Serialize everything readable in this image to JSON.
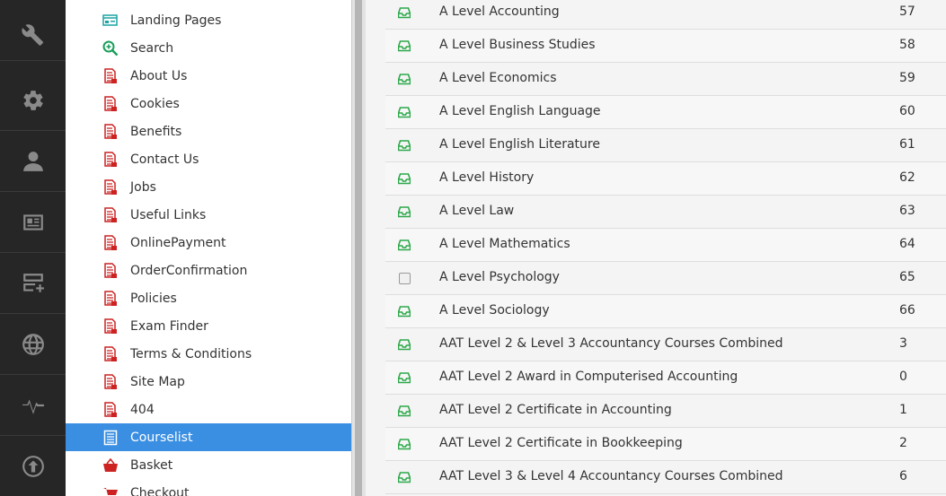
{
  "rail": {
    "icons": [
      "wrench-icon",
      "gear-icon",
      "user-icon",
      "id-card-icon",
      "server-add-icon",
      "globe-icon",
      "pulse-icon",
      "upload-icon"
    ]
  },
  "tree": {
    "items": [
      {
        "label": "Landing Pages",
        "icon": "landing-pages-icon"
      },
      {
        "label": "Search",
        "icon": "search-icon"
      },
      {
        "label": "About Us",
        "icon": "page-icon"
      },
      {
        "label": "Cookies",
        "icon": "page-icon"
      },
      {
        "label": "Benefits",
        "icon": "page-icon"
      },
      {
        "label": "Contact Us",
        "icon": "page-icon"
      },
      {
        "label": "Jobs",
        "icon": "page-icon"
      },
      {
        "label": "Useful Links",
        "icon": "page-icon"
      },
      {
        "label": "OnlinePayment",
        "icon": "page-icon"
      },
      {
        "label": "OrderConfirmation",
        "icon": "page-icon"
      },
      {
        "label": "Policies",
        "icon": "page-icon"
      },
      {
        "label": "Exam Finder",
        "icon": "page-icon"
      },
      {
        "label": "Terms & Conditions",
        "icon": "page-icon"
      },
      {
        "label": "Site Map",
        "icon": "page-icon"
      },
      {
        "label": "404",
        "icon": "page-icon"
      },
      {
        "label": "Courselist",
        "icon": "list-icon",
        "selected": true
      },
      {
        "label": "Basket",
        "icon": "basket-icon"
      },
      {
        "label": "Checkout",
        "icon": "cart-icon"
      }
    ]
  },
  "courses": {
    "rows": [
      {
        "name": "A Level Accounting",
        "id": "57",
        "checkbox": false
      },
      {
        "name": "A Level Business Studies",
        "id": "58",
        "checkbox": false
      },
      {
        "name": "A Level Economics",
        "id": "59",
        "checkbox": false
      },
      {
        "name": "A Level English Language",
        "id": "60",
        "checkbox": false
      },
      {
        "name": "A Level English Literature",
        "id": "61",
        "checkbox": false
      },
      {
        "name": "A Level History",
        "id": "62",
        "checkbox": false
      },
      {
        "name": "A Level Law",
        "id": "63",
        "checkbox": false
      },
      {
        "name": "A Level Mathematics",
        "id": "64",
        "checkbox": false
      },
      {
        "name": "A Level Psychology",
        "id": "65",
        "checkbox": true
      },
      {
        "name": "A Level Sociology",
        "id": "66",
        "checkbox": false
      },
      {
        "name": "AAT Level 2 & Level 3 Accountancy Courses Combined",
        "id": "3",
        "checkbox": false
      },
      {
        "name": "AAT Level 2 Award in Computerised Accounting",
        "id": "0",
        "checkbox": false
      },
      {
        "name": "AAT Level 2 Certificate in Accounting",
        "id": "1",
        "checkbox": false
      },
      {
        "name": "AAT Level 2 Certificate in Bookkeeping",
        "id": "2",
        "checkbox": false
      },
      {
        "name": "AAT Level 3 & Level 4 Accountancy Courses Combined",
        "id": "6",
        "checkbox": false
      }
    ]
  },
  "colors": {
    "rail_bg": "#262626",
    "selected_bg": "#3b8fe2",
    "page_icon": "#cc2222",
    "inbox_icon": "#2ca84a"
  }
}
